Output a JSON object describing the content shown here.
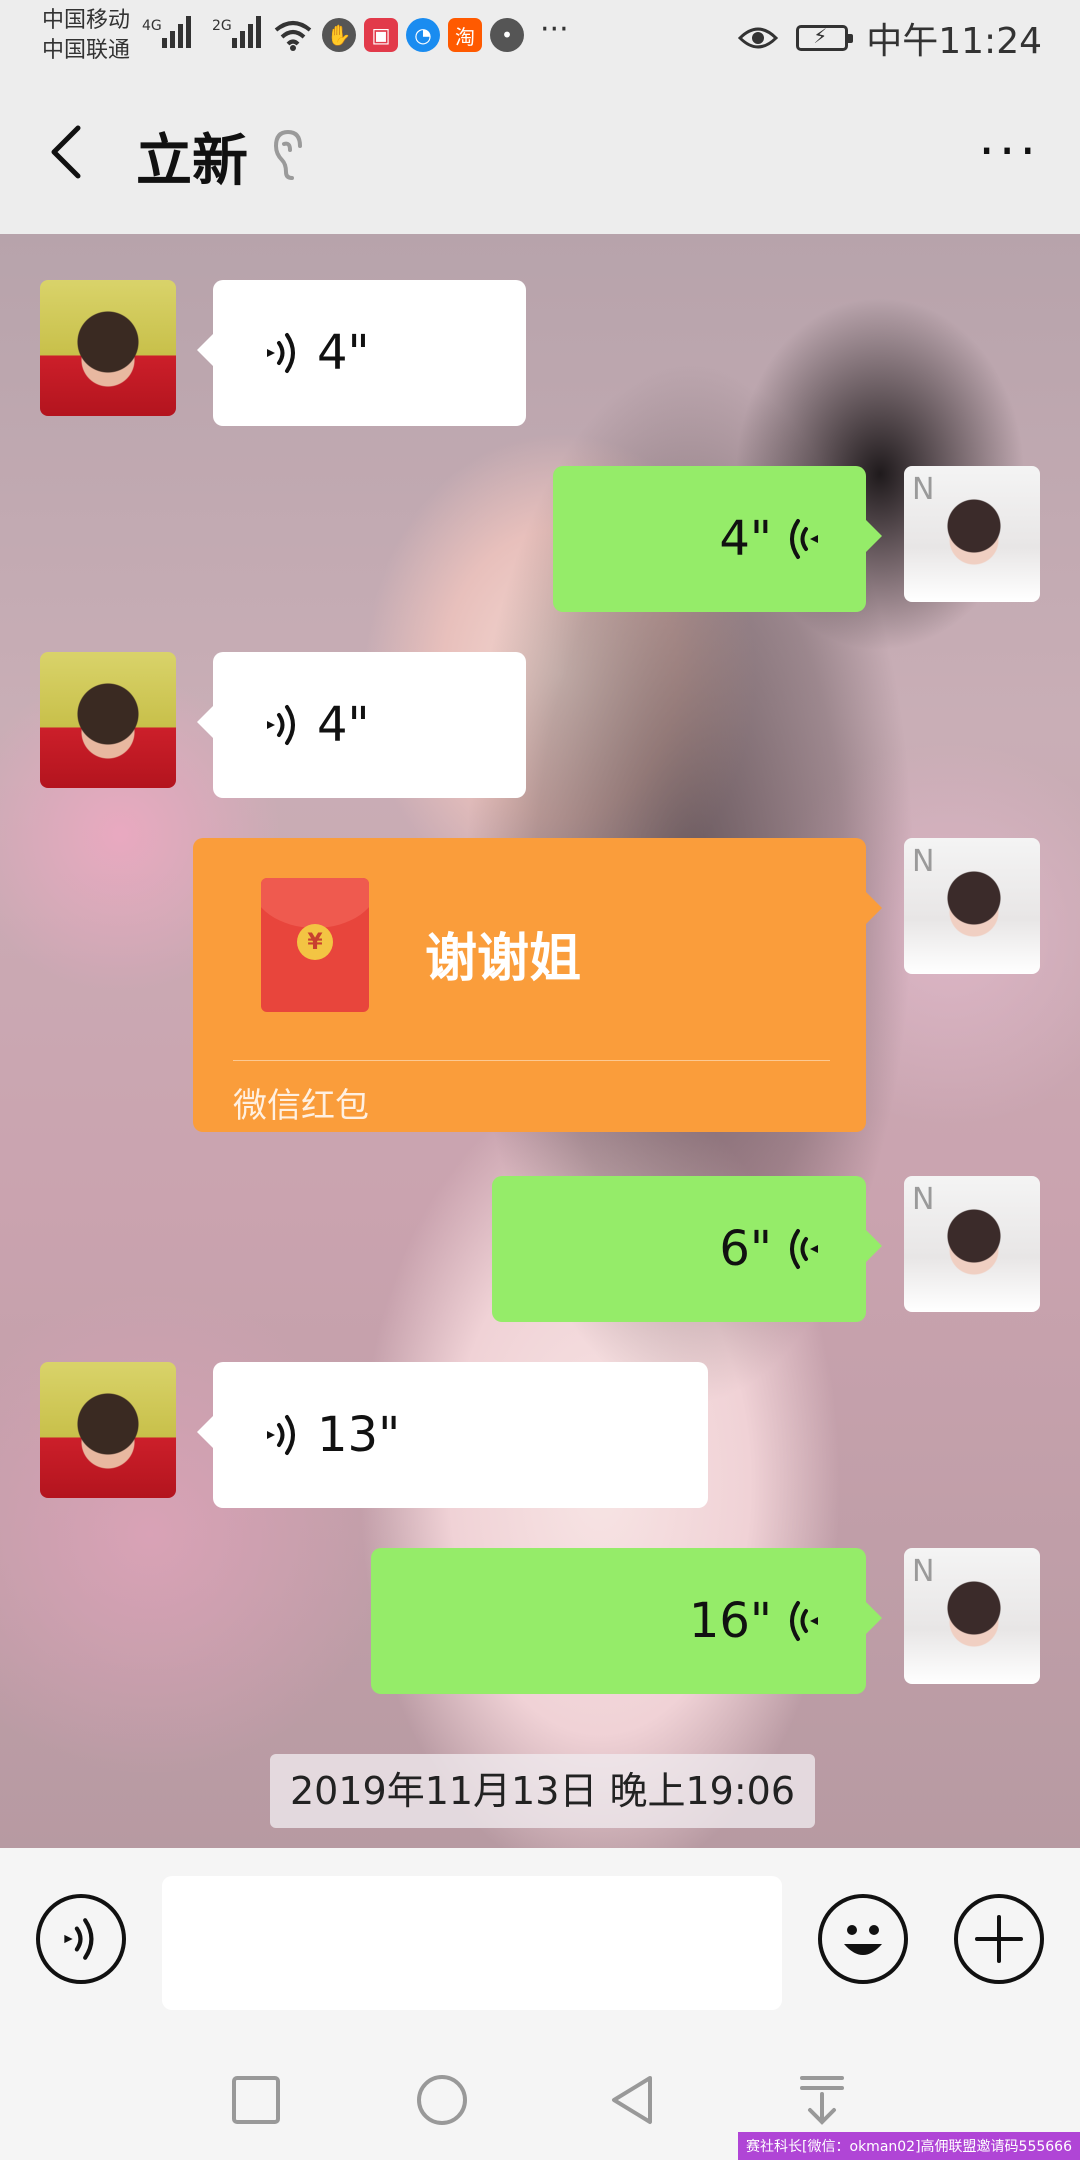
{
  "status_bar": {
    "carrier_1": "中国移动",
    "carrier_2": "中国联通",
    "network_1": "4G",
    "network_2": "2G",
    "time": "中午11:24",
    "app_icons": [
      "wifi-icon",
      "gesture-icon",
      "shop-icon",
      "browser-icon",
      "taobao-icon",
      "chat-icon"
    ],
    "taobao_label": "淘",
    "more": "···"
  },
  "header": {
    "title": "立新",
    "more": "···"
  },
  "messages": [
    {
      "side": "left",
      "type": "voice",
      "duration": "4\""
    },
    {
      "side": "right",
      "type": "voice",
      "duration": "4\""
    },
    {
      "side": "left",
      "type": "voice",
      "duration": "4\""
    },
    {
      "side": "right",
      "type": "red_packet",
      "text": "谢谢姐",
      "label": "微信红包",
      "coin": "¥"
    },
    {
      "side": "right",
      "type": "voice",
      "duration": "6\""
    },
    {
      "side": "left",
      "type": "voice",
      "duration": "13\""
    },
    {
      "side": "right",
      "type": "voice",
      "duration": "16\""
    }
  ],
  "timestamp": "2019年11月13日 晚上19:06",
  "input": {
    "placeholder": ""
  },
  "watermark": "赛社科长[微信：okman02]高佣联盟邀请码555666",
  "colors": {
    "bubble_self": "#95ec69",
    "bubble_other": "#ffffff",
    "red_packet": "#fa9d3b",
    "bar_bg": "#ededed"
  }
}
